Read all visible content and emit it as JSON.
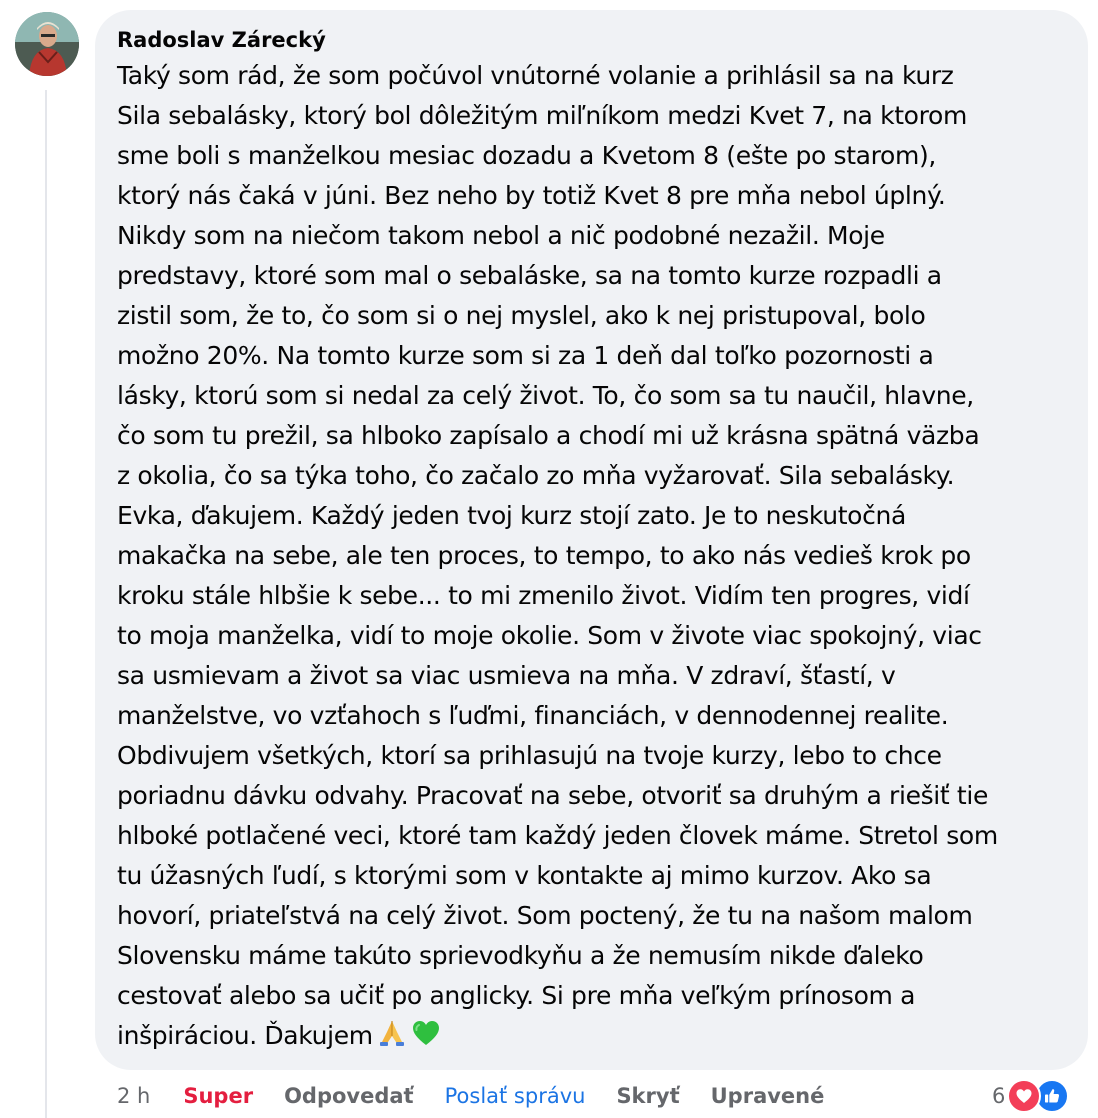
{
  "comment": {
    "author": "Radoslav Zárecký",
    "text_lines": [
      "Taký som rád, že som počúvol vnútorné volanie a prihlásil sa na kurz",
      "Sila sebalásky, ktorý bol dôležitým miľníkom medzi Kvet 7, na ktorom",
      "sme boli s manželkou mesiac dozadu a Kvetom 8 (ešte po starom),",
      "ktorý nás čaká v júni. Bez neho by totiž Kvet 8 pre mňa nebol úplný.",
      "Nikdy som na niečom takom nebol a nič podobné nezažil. Moje",
      "predstavy, ktoré som mal o sebaláske, sa na tomto kurze rozpadli a",
      "zistil som, že to, čo som si o nej myslel, ako k nej pristupoval, bolo",
      "možno 20%. Na tomto kurze som si za 1 deň dal toľko pozornosti a",
      "lásky, ktorú som si nedal za celý život. To, čo som sa tu naučil, hlavne,",
      "čo som tu prežil, sa hlboko zapísalo a chodí mi už krásna spätná väzba",
      "z okolia, čo sa týka toho, čo začalo zo mňa vyžarovať. Sila sebalásky.",
      "Evka, ďakujem. Každý jeden tvoj kurz stojí zato. Je to neskutočná",
      "makačka na sebe, ale ten proces, to tempo, to ako nás vedieš krok po",
      "kroku stále hlbšie k sebe... to mi zmenilo život. Vidím ten progres, vidí",
      "to moja manželka, vidí to moje okolie. Som v živote viac spokojný, viac",
      "sa usmievam a život sa viac usmieva na mňa. V zdraví, šťastí, v",
      "manželstve, vo vzťahoch s ľuďmi, financiách, v dennodennej realite.",
      "Obdivujem všetkých, ktorí sa prihlasujú na tvoje kurzy, lebo to chce",
      "poriadnu dávku odvahy. Pracovať na sebe, otvoriť sa druhým a riešiť tie",
      "hlboké potlačené veci, ktoré tam každý jeden človek máme. Stretol som",
      "tu úžasných ľudí, s ktorými som v kontakte aj mimo kurzov. Ako sa",
      "hovorí, priateľstvá na celý život. Som poctený, že tu na našom malom",
      "Slovensku máme takúto sprievodkyňu a že nemusím nikde ďaleko",
      "cestovať alebo sa učiť po anglicky. Si pre mňa veľkým prínosom a",
      "inšpiráciou. Ďakujem"
    ],
    "emojis": [
      "folded-hands-icon",
      "green-heart-icon"
    ]
  },
  "actions": {
    "time": "2 h",
    "reaction_label": "Super",
    "reply": "Odpovedať",
    "send_message": "Poslať správu",
    "hide": "Skryť",
    "edited": "Upravené"
  },
  "reactions": {
    "count": "6",
    "icons": [
      "love-reaction-icon",
      "like-reaction-icon"
    ]
  },
  "colors": {
    "bubble": "#f0f2f5",
    "text": "#050505",
    "secondary": "#65676b",
    "super": "#e41e3f",
    "link": "#1b74e4",
    "love": "#f33e58",
    "like": "#1877f2"
  }
}
